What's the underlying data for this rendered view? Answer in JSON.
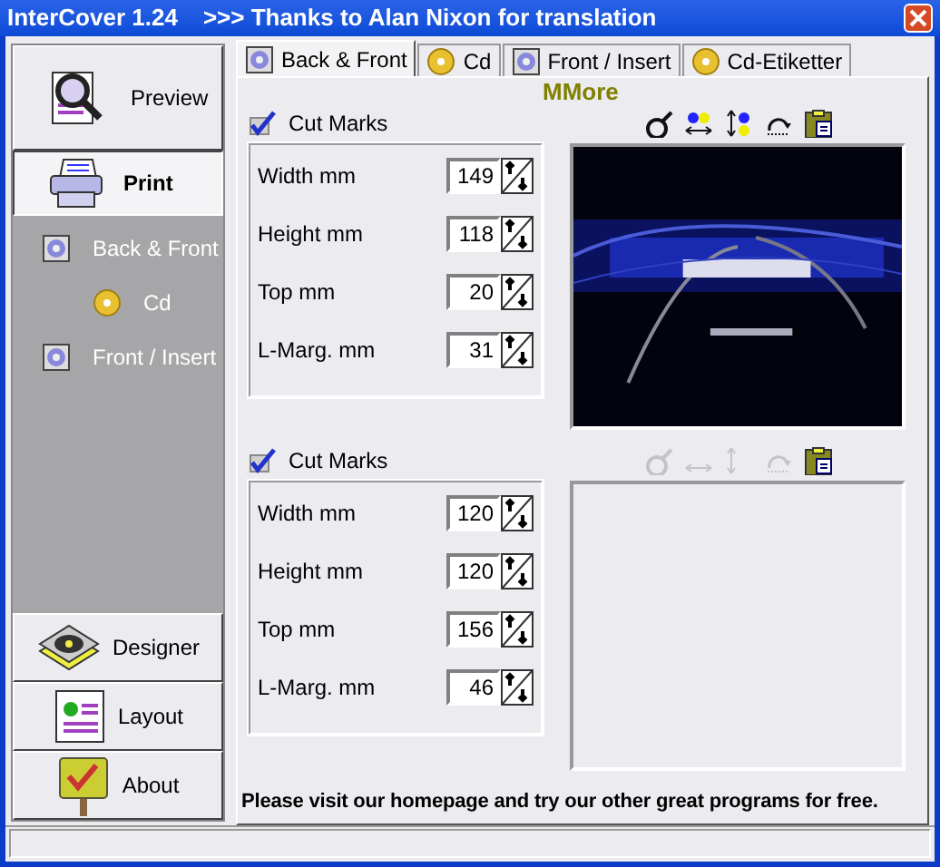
{
  "window": {
    "title": "InterCover 1.24",
    "subtitle": ">>> Thanks to Alan Nixon for translation"
  },
  "sidebar": {
    "top_buttons": [
      {
        "label": "Preview",
        "kind": "preview",
        "selected": false
      },
      {
        "label": "Print",
        "kind": "print",
        "selected": true
      }
    ],
    "items": [
      {
        "label": "Back & Front",
        "kind": "case"
      },
      {
        "label": "Cd",
        "kind": "cd"
      },
      {
        "label": "Front / Insert",
        "kind": "case"
      }
    ],
    "bottom_buttons": [
      {
        "label": "Designer",
        "kind": "designer",
        "selected": false
      },
      {
        "label": "Layout",
        "kind": "layout",
        "selected": false
      },
      {
        "label": "About",
        "kind": "about",
        "selected": false
      }
    ]
  },
  "tabs": [
    {
      "label": "Back & Front",
      "kind": "case",
      "selected": true
    },
    {
      "label": "Cd",
      "kind": "cd",
      "selected": false
    },
    {
      "label": "Front / Insert",
      "kind": "case",
      "selected": false
    },
    {
      "label": "Cd-Etiketter",
      "kind": "cd",
      "selected": false
    }
  ],
  "more_link": "MMore",
  "sections": [
    {
      "cut_marks": {
        "label": "Cut Marks",
        "checked": true
      },
      "fields": [
        {
          "label": "Width mm",
          "value": "149"
        },
        {
          "label": "Height mm",
          "value": "118"
        },
        {
          "label": "Top mm",
          "value": "20"
        },
        {
          "label": "L-Marg. mm",
          "value": "31"
        }
      ],
      "toolbar": [
        {
          "kind": "zoom",
          "disabled": false
        },
        {
          "kind": "hflip",
          "disabled": false
        },
        {
          "kind": "vflip",
          "disabled": false
        },
        {
          "kind": "rotate",
          "disabled": false
        },
        {
          "kind": "paste",
          "disabled": false
        }
      ],
      "preview": {
        "kind": "picture"
      }
    },
    {
      "cut_marks": {
        "label": "Cut Marks",
        "checked": true
      },
      "fields": [
        {
          "label": "Width mm",
          "value": "120"
        },
        {
          "label": "Height mm",
          "value": "120"
        },
        {
          "label": "Top mm",
          "value": "156"
        },
        {
          "label": "L-Marg. mm",
          "value": "46"
        }
      ],
      "toolbar": [
        {
          "kind": "zoom",
          "disabled": true
        },
        {
          "kind": "hflip",
          "disabled": true
        },
        {
          "kind": "vflip",
          "disabled": true
        },
        {
          "kind": "rotate",
          "disabled": true
        },
        {
          "kind": "paste",
          "disabled": false
        }
      ]
    }
  ],
  "footer": "Please visit our homepage and try our other great programs for free."
}
